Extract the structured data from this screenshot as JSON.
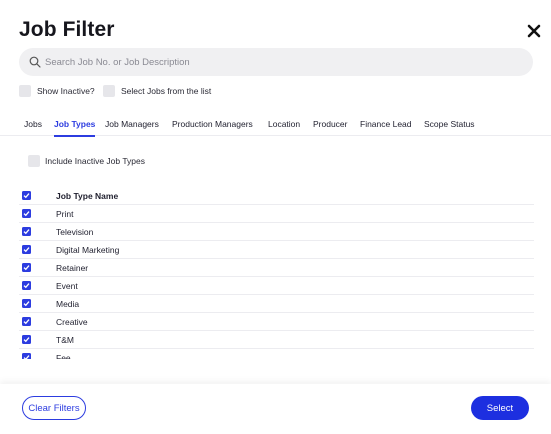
{
  "dialog": {
    "title": "Job Filter",
    "close_icon": "close-icon"
  },
  "search": {
    "placeholder": "Search Job No. or Job Description",
    "value": ""
  },
  "options": {
    "show_inactive": "Show Inactive?",
    "select_from_list": "Select Jobs from the list"
  },
  "tabs": [
    {
      "label": "Jobs",
      "active": false
    },
    {
      "label": "Job Types",
      "active": true
    },
    {
      "label": "Job Managers",
      "active": false
    },
    {
      "label": "Production Managers",
      "active": false
    },
    {
      "label": "Location",
      "active": false
    },
    {
      "label": "Producer",
      "active": false
    },
    {
      "label": "Finance Lead",
      "active": false
    },
    {
      "label": "Scope Status",
      "active": false
    }
  ],
  "include_inactive": "Include Inactive Job Types",
  "table": {
    "header": "Job Type Name",
    "rows": [
      "Print",
      "Television",
      "Digital Marketing",
      "Retainer",
      "Event",
      "Media",
      "Creative",
      "T&M",
      "Fee"
    ]
  },
  "footer": {
    "clear_label": "Clear Filters",
    "select_label": "Select"
  },
  "colors": {
    "accent": "#2c3ce0",
    "button": "#1d2fe0",
    "field_bg": "#f0f0f2"
  }
}
